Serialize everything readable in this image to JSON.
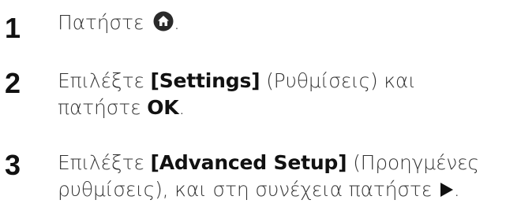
{
  "steps": [
    {
      "number": "1",
      "text_before": "Πατήστε ",
      "icon": "home-button-icon",
      "text_after": "."
    },
    {
      "number": "2",
      "line1_prefix": "Επιλέξτε ",
      "line1_bold": "[Settings]",
      "line1_suffix": " (Ρυθμίσεις) και",
      "line2_prefix": "πατήστε ",
      "line2_bold": "OK",
      "line2_suffix": "."
    },
    {
      "number": "3",
      "line1_prefix": "Επιλέξτε ",
      "line1_bold": "[Advanced Setup]",
      "line1_suffix": " (Προηγμένες",
      "line2_text": "ρυθμίσεις), και στη συνέχεια πατήστε ",
      "icon": "play-right-arrow-icon",
      "line2_suffix": "."
    }
  ]
}
